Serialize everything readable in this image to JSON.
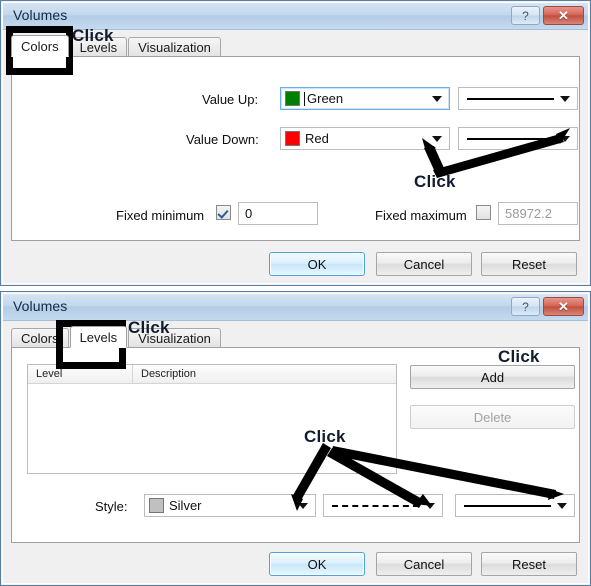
{
  "dialog1": {
    "title": "Volumes",
    "titlebar": {
      "help_label": "?",
      "close_label": "✕"
    },
    "tabs": [
      {
        "label": "Colors",
        "active": true
      },
      {
        "label": "Levels",
        "active": false
      },
      {
        "label": "Visualization",
        "active": false
      }
    ],
    "fields": {
      "value_up_label": "Value Up:",
      "value_up_color_name": "Green",
      "value_up_color_hex": "#008000",
      "value_down_label": "Value Down:",
      "value_down_color_name": "Red",
      "value_down_color_hex": "#FF0000",
      "fixed_minimum_label": "Fixed minimum",
      "fixed_minimum_checked": true,
      "fixed_minimum_value": "0",
      "fixed_maximum_label": "Fixed maximum",
      "fixed_maximum_checked": false,
      "fixed_maximum_value": "58972.2"
    },
    "buttons": {
      "ok": "OK",
      "cancel": "Cancel",
      "reset": "Reset"
    }
  },
  "dialog2": {
    "title": "Volumes",
    "titlebar": {
      "help_label": "?",
      "close_label": "✕"
    },
    "tabs": [
      {
        "label": "Colors",
        "active": false
      },
      {
        "label": "Levels",
        "active": true
      },
      {
        "label": "Visualization",
        "active": false
      }
    ],
    "level_list": {
      "columns": [
        "Level",
        "Description"
      ],
      "rows": []
    },
    "side_buttons": {
      "add": "Add",
      "delete": "Delete",
      "delete_disabled": true
    },
    "style": {
      "label": "Style:",
      "color_name": "Silver",
      "color_hex": "#C0C0C0",
      "line_style": "dashed",
      "line_width": "solid"
    },
    "buttons": {
      "ok": "OK",
      "cancel": "Cancel",
      "reset": "Reset"
    }
  },
  "annotations": {
    "click_colors_tab": "Click",
    "click_value_down": "Click",
    "click_levels_tab": "Click",
    "click_add_button": "Click",
    "click_style_row": "Click"
  }
}
